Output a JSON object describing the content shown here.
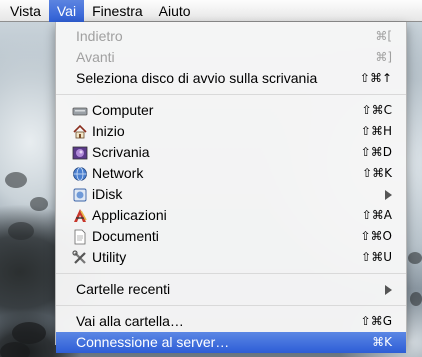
{
  "menubar": {
    "items": [
      {
        "label": "Vista",
        "active": false
      },
      {
        "label": "Vai",
        "active": true
      },
      {
        "label": "Finestra",
        "active": false
      },
      {
        "label": "Aiuto",
        "active": false
      }
    ]
  },
  "menu": {
    "nav": [
      {
        "label": "Indietro",
        "shortcut": "⌘[",
        "disabled": true
      },
      {
        "label": "Avanti",
        "shortcut": "⌘]",
        "disabled": true
      },
      {
        "label": "Seleziona disco di avvio sulla scrivania",
        "shortcut": "⇧⌘↑",
        "disabled": false
      }
    ],
    "places": [
      {
        "label": "Computer",
        "shortcut": "⇧⌘C",
        "icon": "computer-icon"
      },
      {
        "label": "Inizio",
        "shortcut": "⇧⌘H",
        "icon": "home-icon"
      },
      {
        "label": "Scrivania",
        "shortcut": "⇧⌘D",
        "icon": "desktop-icon"
      },
      {
        "label": "Network",
        "shortcut": "⇧⌘K",
        "icon": "network-globe-icon"
      },
      {
        "label": "iDisk",
        "shortcut": "",
        "icon": "idisk-icon",
        "submenu": true
      },
      {
        "label": "Applicazioni",
        "shortcut": "⇧⌘A",
        "icon": "applications-icon"
      },
      {
        "label": "Documenti",
        "shortcut": "⇧⌘O",
        "icon": "documents-icon"
      },
      {
        "label": "Utility",
        "shortcut": "⇧⌘U",
        "icon": "utilities-icon"
      }
    ],
    "recent": {
      "label": "Cartelle recenti",
      "submenu": true
    },
    "goto": [
      {
        "label": "Vai alla cartella…",
        "shortcut": "⇧⌘G",
        "highlighted": false
      },
      {
        "label": "Connessione al server…",
        "shortcut": "⌘K",
        "highlighted": true
      }
    ]
  },
  "colors": {
    "highlight": "#2f5fd6",
    "menu_bg": "#f6f6f6",
    "disabled_text": "#a0a0a0"
  }
}
